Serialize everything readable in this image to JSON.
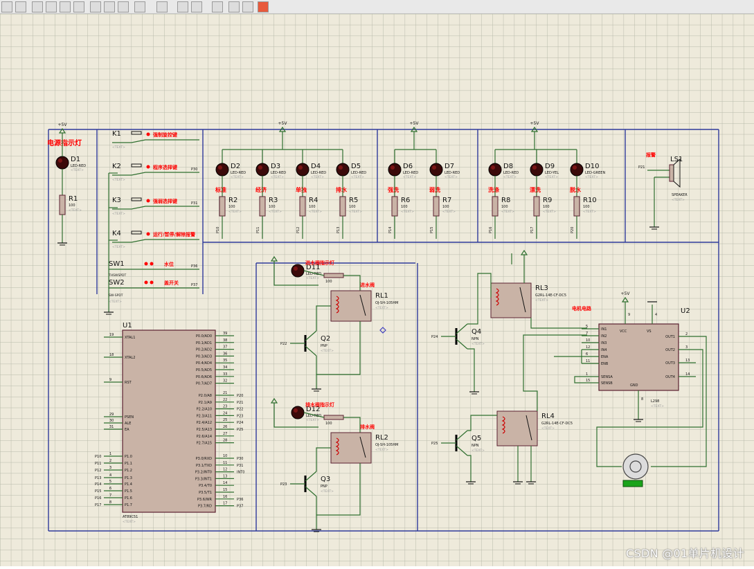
{
  "app": {
    "toolbar_icons": [
      "grid-icon",
      "zoom-in-icon",
      "zoom-out-icon",
      "zoom-fit-icon",
      "undo-icon",
      "redo-icon",
      "cut-icon",
      "copy-icon",
      "paste-icon",
      "wire-icon",
      "block-icon",
      "tag-icon",
      "bus-icon",
      "component-icon",
      "netlist-icon",
      "bom-icon",
      "design-icon"
    ]
  },
  "schematic": {
    "colors": {
      "sheet": "#eeeadb",
      "grid": "#b7b9aa",
      "frame": "#2e3a9b",
      "wire": "#2f6f2f",
      "part": "#c9b3a6",
      "part_border": "#5a2030",
      "red": "#ff0000",
      "text": "#111111",
      "dim": "#9a9a9a"
    },
    "labels": {
      "power_indicator": "电源指示灯",
      "vcc": "+5V",
      "text_placeholder": "<TEXT>",
      "K1_label": "强制旋控键",
      "K2_label": "程序选择键",
      "K3_label": "强弱选择键",
      "K4_label": "运行/暂停/解除报警",
      "SW1_label": "水位",
      "SW2_label": "盖开关",
      "switch_part": "THSWSPDT",
      "switch_part2": "SW-SPDT",
      "D11_label": "进水阀指示灯",
      "D12_label": "排水阀指示灯",
      "RL1_label": "进水阀",
      "RL2_label": "排水阀",
      "motor_label": "电机电路",
      "buzzer_label": "报警"
    },
    "leds_top": [
      {
        "ref": "D2",
        "part": "LED-RED",
        "func": "标准"
      },
      {
        "ref": "D3",
        "part": "LED-RED",
        "func": "经济"
      },
      {
        "ref": "D4",
        "part": "LED-RED",
        "func": "单独"
      },
      {
        "ref": "D5",
        "part": "LED-RED",
        "func": "排水"
      },
      {
        "ref": "D6",
        "part": "LED-RED",
        "func": "强洗"
      },
      {
        "ref": "D7",
        "part": "LED-RED",
        "func": "弱洗"
      },
      {
        "ref": "D8",
        "part": "LED-RED",
        "func": "洗涤"
      },
      {
        "ref": "D9",
        "part": "LED-YEL",
        "func": "漂洗"
      },
      {
        "ref": "D10",
        "part": "LED-GREEN",
        "func": "脱水"
      }
    ],
    "resistors_top": [
      {
        "ref": "R2",
        "val": "100",
        "net": "P10"
      },
      {
        "ref": "R3",
        "val": "100",
        "net": "P11"
      },
      {
        "ref": "R4",
        "val": "100",
        "net": "P12"
      },
      {
        "ref": "R5",
        "val": "100",
        "net": "P13"
      },
      {
        "ref": "R6",
        "val": "100",
        "net": "P14"
      },
      {
        "ref": "R7",
        "val": "100",
        "net": "P15"
      },
      {
        "ref": "R8",
        "val": "100",
        "net": "P16"
      },
      {
        "ref": "R9",
        "val": "100",
        "net": "P17"
      },
      {
        "ref": "R10",
        "val": "100",
        "net": "P20"
      }
    ],
    "D1": {
      "ref": "D1",
      "part": "LED-RED"
    },
    "R1": {
      "ref": "R1",
      "val": "100"
    },
    "keys": [
      {
        "ref": "K1",
        "net": ""
      },
      {
        "ref": "K2",
        "net": "P30"
      },
      {
        "ref": "K3",
        "net": "P31"
      },
      {
        "ref": "K4",
        "net": ""
      }
    ],
    "switches": [
      {
        "ref": "SW1",
        "net": "P36"
      },
      {
        "ref": "SW2",
        "net": "P37"
      }
    ],
    "U1": {
      "ref": "U1",
      "part": "AT89C51",
      "left_pins": [
        {
          "num": "19",
          "name": "XTAL1"
        },
        {
          "num": "18",
          "name": "XTAL2"
        },
        {
          "num": "9",
          "name": "RST"
        },
        {
          "num": "29",
          "name": "PSEN"
        },
        {
          "num": "30",
          "name": "ALE"
        },
        {
          "num": "31",
          "name": "EA"
        },
        {
          "num": "1",
          "name": "P1.0"
        },
        {
          "num": "2",
          "name": "P1.1"
        },
        {
          "num": "3",
          "name": "P1.2"
        },
        {
          "num": "4",
          "name": "P1.3"
        },
        {
          "num": "5",
          "name": "P1.4"
        },
        {
          "num": "6",
          "name": "P1.5"
        },
        {
          "num": "7",
          "name": "P1.6"
        },
        {
          "num": "8",
          "name": "P1.7"
        }
      ],
      "left_nets": [
        "P10",
        "P11",
        "P12",
        "P13",
        "P14",
        "P15",
        "P16",
        "P17"
      ],
      "right_pins": [
        {
          "num": "39",
          "name": "P0.0/AD0"
        },
        {
          "num": "38",
          "name": "P0.1/AD1"
        },
        {
          "num": "37",
          "name": "P0.2/AD2"
        },
        {
          "num": "36",
          "name": "P0.3/AD3"
        },
        {
          "num": "35",
          "name": "P0.4/AD4"
        },
        {
          "num": "34",
          "name": "P0.5/AD5"
        },
        {
          "num": "33",
          "name": "P0.6/AD6"
        },
        {
          "num": "32",
          "name": "P0.7/AD7"
        },
        {
          "num": "21",
          "name": "P2.0/A8"
        },
        {
          "num": "22",
          "name": "P2.1/A9"
        },
        {
          "num": "23",
          "name": "P2.2/A10"
        },
        {
          "num": "24",
          "name": "P2.3/A11"
        },
        {
          "num": "25",
          "name": "P2.4/A12"
        },
        {
          "num": "26",
          "name": "P2.5/A13"
        },
        {
          "num": "27",
          "name": "P2.6/A14"
        },
        {
          "num": "28",
          "name": "P2.7/A15"
        },
        {
          "num": "10",
          "name": "P3.0/RXD"
        },
        {
          "num": "11",
          "name": "P3.1/TXD"
        },
        {
          "num": "12",
          "name": "P3.2/INT0"
        },
        {
          "num": "13",
          "name": "P3.3/INT1"
        },
        {
          "num": "14",
          "name": "P3.4/T0"
        },
        {
          "num": "15",
          "name": "P3.5/T1"
        },
        {
          "num": "16",
          "name": "P3.6/WR"
        },
        {
          "num": "17",
          "name": "P3.7/RD"
        }
      ],
      "right_nets": [
        "P20",
        "P21",
        "P22",
        "P23",
        "P24",
        "P25",
        "",
        "",
        "P30",
        "P31",
        "INT0",
        "",
        "",
        "",
        "P36",
        "P37"
      ]
    },
    "Q2": {
      "ref": "Q2",
      "part": "PNP",
      "net": "P22"
    },
    "Q3": {
      "ref": "Q3",
      "part": "PNP",
      "net": "P23"
    },
    "Q4": {
      "ref": "Q4",
      "part": "NPN",
      "net": "P24"
    },
    "Q5": {
      "ref": "Q5",
      "part": "NPN",
      "net": "P25"
    },
    "D11": {
      "ref": "D11",
      "part": "LED-RED"
    },
    "D12": {
      "ref": "D12",
      "part": "LED-RED"
    },
    "RL1": {
      "ref": "RL1",
      "part": "OJ-SH-105HM"
    },
    "RL2": {
      "ref": "RL2",
      "part": "OJ-SH-105HM"
    },
    "RL3": {
      "ref": "RL3",
      "part": "G2RL-14E-CF-DC5"
    },
    "RL4": {
      "ref": "RL4",
      "part": "G2RL-14E-CF-DC5"
    },
    "U2": {
      "ref": "U2",
      "part": "L298",
      "left": [
        {
          "num": "5",
          "name": "IN1"
        },
        {
          "num": "7",
          "name": "IN2"
        },
        {
          "num": "10",
          "name": "IN3"
        },
        {
          "num": "12",
          "name": "IN4"
        },
        {
          "num": "6",
          "name": "ENA"
        },
        {
          "num": "11",
          "name": "ENB"
        },
        {
          "num": "1",
          "name": "SENSA"
        },
        {
          "num": "15",
          "name": "SENSB"
        }
      ],
      "right": [
        {
          "num": "2",
          "name": "OUT1"
        },
        {
          "num": "3",
          "name": "OUT2"
        },
        {
          "num": "13",
          "name": "OUT3"
        },
        {
          "num": "14",
          "name": "OUT4"
        }
      ],
      "top": [
        {
          "num": "9",
          "name": "VCC"
        },
        {
          "num": "4",
          "name": "VS"
        }
      ],
      "bottom": [
        {
          "num": "8",
          "name": "GND"
        }
      ]
    },
    "LS1": {
      "ref": "LS1",
      "part": "SPEAKER",
      "net": "P21"
    },
    "resistor_100": "100"
  },
  "watermark": "CSDN @01单片机设计"
}
